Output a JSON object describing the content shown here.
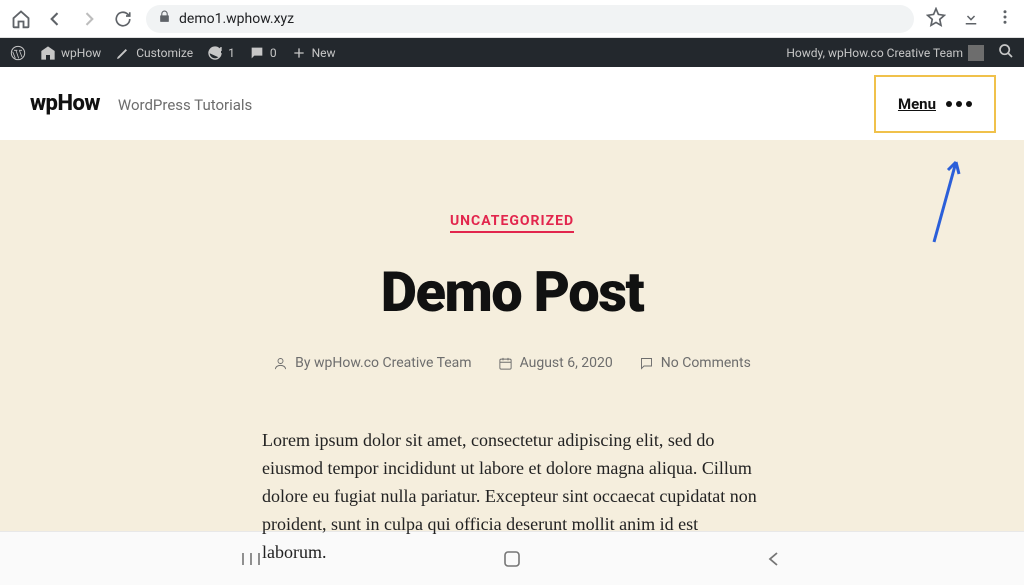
{
  "browser": {
    "url": "demo1.wphow.xyz"
  },
  "wp_bar": {
    "site_name": "wpHow",
    "customize": "Customize",
    "updates": "1",
    "comments": "0",
    "new": "New",
    "greeting": "Howdy, wpHow.co Creative Team"
  },
  "header": {
    "title": "wpHow",
    "tagline": "WordPress Tutorials",
    "menu_label": "Menu"
  },
  "post": {
    "category": "UNCATEGORIZED",
    "title": "Demo Post",
    "author_prefix": "By",
    "author": "wpHow.co Creative Team",
    "date": "August 6, 2020",
    "comments": "No Comments",
    "body": "Lorem ipsum dolor sit amet, consectetur adipiscing elit, sed do eiusmod tempor incididunt ut labore et dolore magna aliqua. Cillum dolore eu fugiat nulla pariatur. Excepteur sint occaecat cupidatat non proident, sunt in culpa qui officia deserunt mollit anim id est laborum."
  }
}
